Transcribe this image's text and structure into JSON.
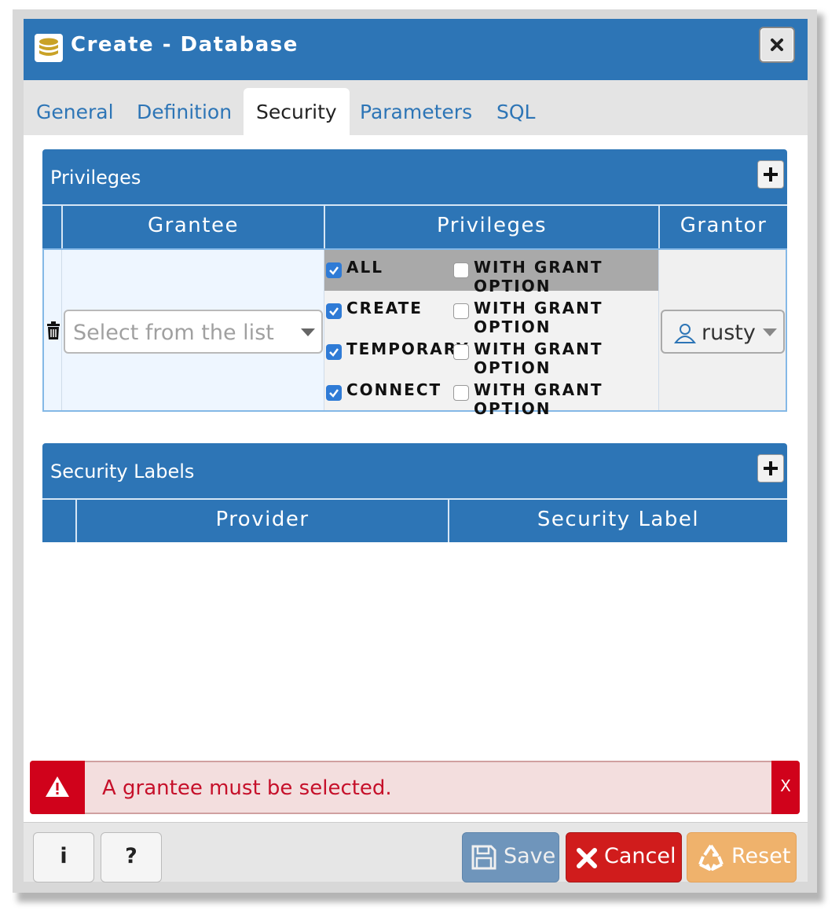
{
  "dialog": {
    "title": "Create - Database",
    "tabs": [
      {
        "label": "General"
      },
      {
        "label": "Definition"
      },
      {
        "label": "Security"
      },
      {
        "label": "Parameters"
      },
      {
        "label": "SQL"
      }
    ],
    "active_tab": "Security"
  },
  "privileges_panel": {
    "title": "Privileges",
    "columns": [
      "Grantee",
      "Privileges",
      "Grantor"
    ],
    "row": {
      "grantee_placeholder": "Select from the list",
      "privileges": [
        {
          "name": "ALL",
          "checked": true,
          "grant_option_label": "WITH GRANT OPTION",
          "grant_option_checked": false
        },
        {
          "name": "CREATE",
          "checked": true,
          "grant_option_label": "WITH GRANT OPTION",
          "grant_option_checked": false
        },
        {
          "name": "TEMPORARY",
          "checked": true,
          "grant_option_label": "WITH GRANT OPTION",
          "grant_option_checked": false
        },
        {
          "name": "CONNECT",
          "checked": true,
          "grant_option_label": "WITH GRANT OPTION",
          "grant_option_checked": false
        }
      ],
      "grantor": "rusty"
    }
  },
  "security_labels_panel": {
    "title": "Security Labels",
    "columns": [
      "Provider",
      "Security Label"
    ]
  },
  "alert": {
    "message": "A grantee must be selected.",
    "close_label": "X"
  },
  "footer": {
    "info_label": "i",
    "help_label": "?",
    "save_label": "Save",
    "cancel_label": "Cancel",
    "reset_label": "Reset"
  },
  "colors": {
    "primary": "#2d75b6",
    "danger": "#d0021b",
    "save": "#6f95bb",
    "cancel": "#d01c1c",
    "reset": "#efb26c",
    "checkbox": "#2f7bd6"
  },
  "icons": [
    "database-icon",
    "close-icon",
    "add-icon",
    "trash-icon",
    "caret-down-icon",
    "user-icon",
    "warning-icon",
    "info-icon",
    "help-icon",
    "save-icon",
    "x-icon",
    "recycle-icon"
  ]
}
